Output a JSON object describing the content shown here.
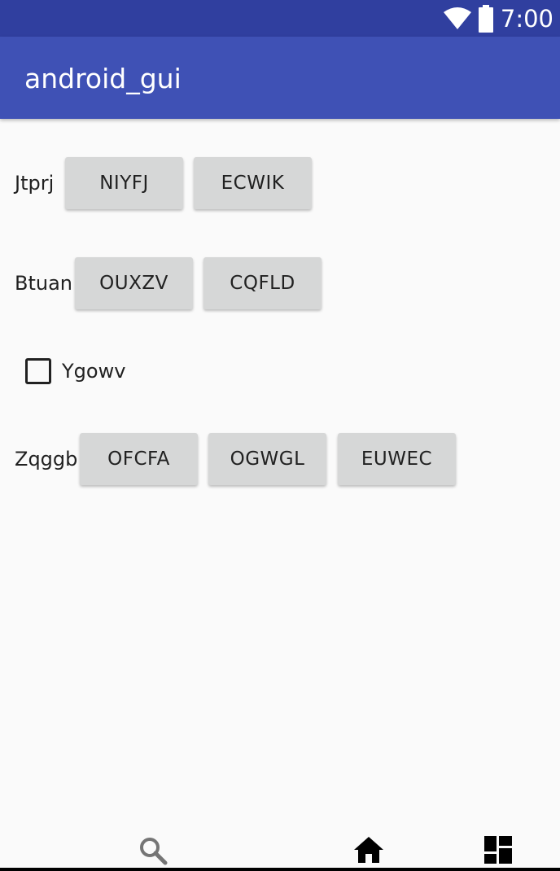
{
  "status_bar": {
    "time": "7:00",
    "icons": [
      "wifi-icon",
      "battery-icon"
    ],
    "color": "#303f9f"
  },
  "app_bar": {
    "title": "android_gui",
    "color": "#3f51b5"
  },
  "rows": [
    {
      "label": "Jtprj",
      "buttons": [
        "NIYFJ",
        "ECWIK"
      ]
    },
    {
      "label": "Btuan",
      "buttons": [
        "OUXZV",
        "CQFLD"
      ]
    },
    {
      "label": "Zqggb",
      "buttons": [
        "OFCFA",
        "OGWGL",
        "EUWEC"
      ]
    }
  ],
  "checkbox": {
    "label": "Ygowv",
    "checked": false
  },
  "nav_bar": {
    "icons": [
      "search-icon",
      "home-icon",
      "dashboard-icon"
    ]
  }
}
